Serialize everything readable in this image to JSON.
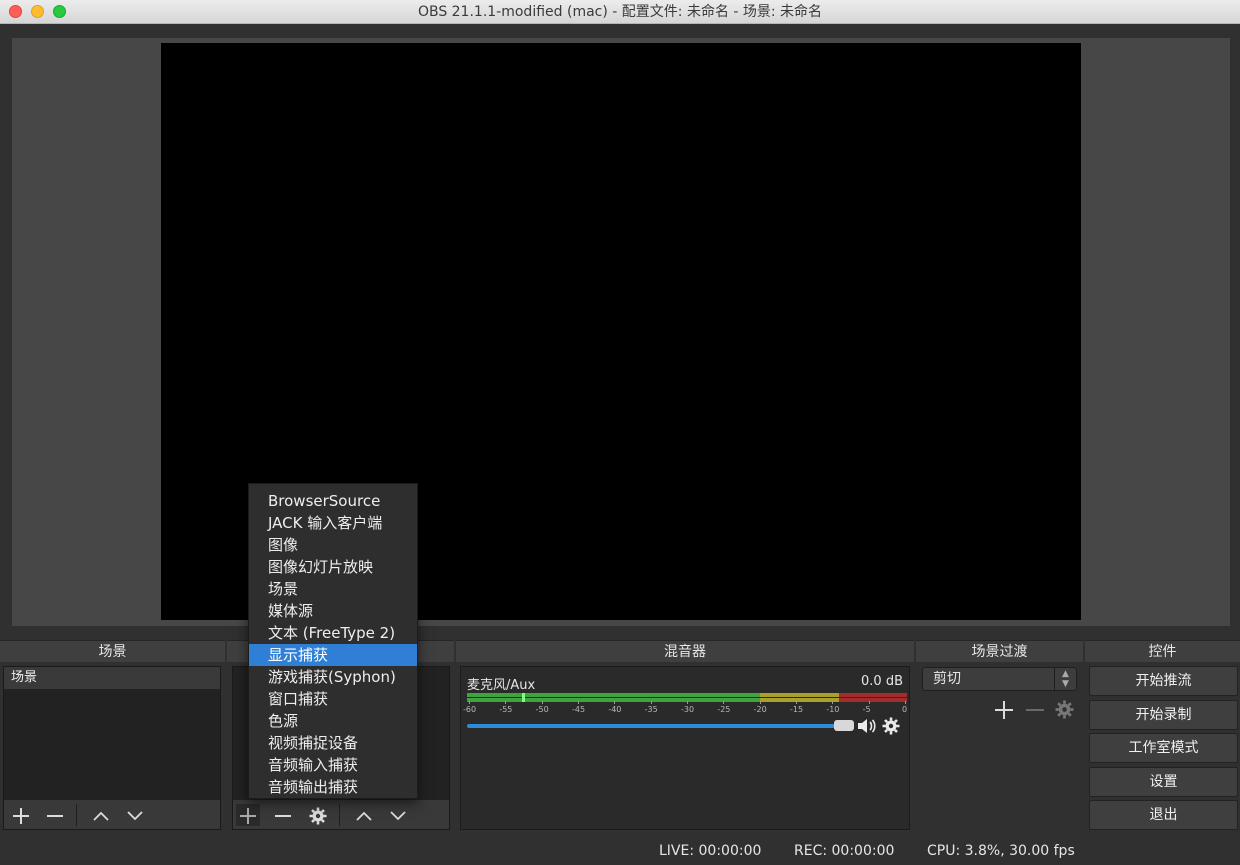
{
  "window": {
    "title": "OBS 21.1.1-modified (mac) - 配置文件: 未命名 - 场景: 未命名"
  },
  "docks": {
    "scenes_title": "场景",
    "sources_title": "",
    "mixer_title": "混音器",
    "transitions_title": "场景过渡",
    "controls_title": "控件"
  },
  "scenes": {
    "items": [
      "场景"
    ]
  },
  "add_source_menu": {
    "items": [
      "BrowserSource",
      "JACK 输入客户端",
      "图像",
      "图像幻灯片放映",
      "场景",
      "媒体源",
      "文本 (FreeType 2)",
      "显示捕获",
      "游戏捕获(Syphon)",
      "窗口捕获",
      "色源",
      "视频捕捉设备",
      "音频输入捕获",
      "音频输出捕获"
    ],
    "selected": "显示捕获"
  },
  "mixer": {
    "channel_name": "麦克风/Aux",
    "level": "0.0 dB",
    "scale_labels": [
      "-60",
      "-55",
      "-50",
      "-45",
      "-40",
      "-35",
      "-30",
      "-25",
      "-20",
      "-15",
      "-10",
      "-5",
      "0"
    ],
    "volume_fraction": 0.97
  },
  "transitions": {
    "selected": "剪切"
  },
  "controls": {
    "start_streaming": "开始推流",
    "start_recording": "开始录制",
    "studio_mode": "工作室模式",
    "settings": "设置",
    "exit": "退出"
  },
  "status": {
    "live": "LIVE: 00:00:00",
    "rec": "REC: 00:00:00",
    "cpu": "CPU: 3.8%, 30.00 fps"
  },
  "colors": {
    "accent": "#2f7fd6",
    "meter_green": "#3fa33f",
    "meter_yellow": "#a8a22b",
    "meter_red": "#a32c2c"
  }
}
